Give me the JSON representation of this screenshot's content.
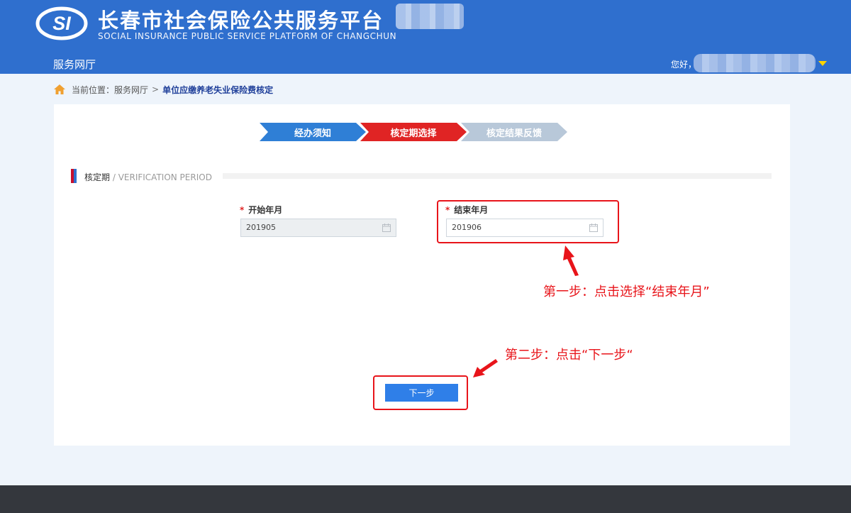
{
  "header": {
    "title": "长春市社会保险公共服务平台",
    "subtitle": "SOCIAL INSURANCE PUBLIC SERVICE PLATFORM OF CHANGCHUN",
    "logo_text": "SI",
    "nav_hall": "服务网厅",
    "greeting": "您好，"
  },
  "breadcrumb": {
    "prefix": "当前位置：",
    "root": "服务网厅",
    "separator": ">",
    "current": "单位应缴养老失业保险费核定"
  },
  "steps": [
    "经办须知",
    "核定期选择",
    "核定结果反馈"
  ],
  "active_step": 2,
  "section": {
    "title": "核定期",
    "title_en": " / VERIFICATION PERIOD"
  },
  "form": {
    "required_mark": "*",
    "start_label": "开始年月",
    "start_value": "201905",
    "end_label": "结束年月",
    "end_value": "201906"
  },
  "next_button": "下一步",
  "annotations": {
    "step1": "第一步：点击选择“结束年月”",
    "step2": "第二步：点击“下一步“"
  },
  "colors": {
    "header": "#2f6fce",
    "step_done": "#2f7fd6",
    "step_active": "#e02424",
    "step_todo": "#b8c8d9",
    "annotation": "#e8141a",
    "button": "#2f7fe8"
  },
  "icons": [
    "home-icon",
    "calendar-icon",
    "chevron-down-icon"
  ]
}
